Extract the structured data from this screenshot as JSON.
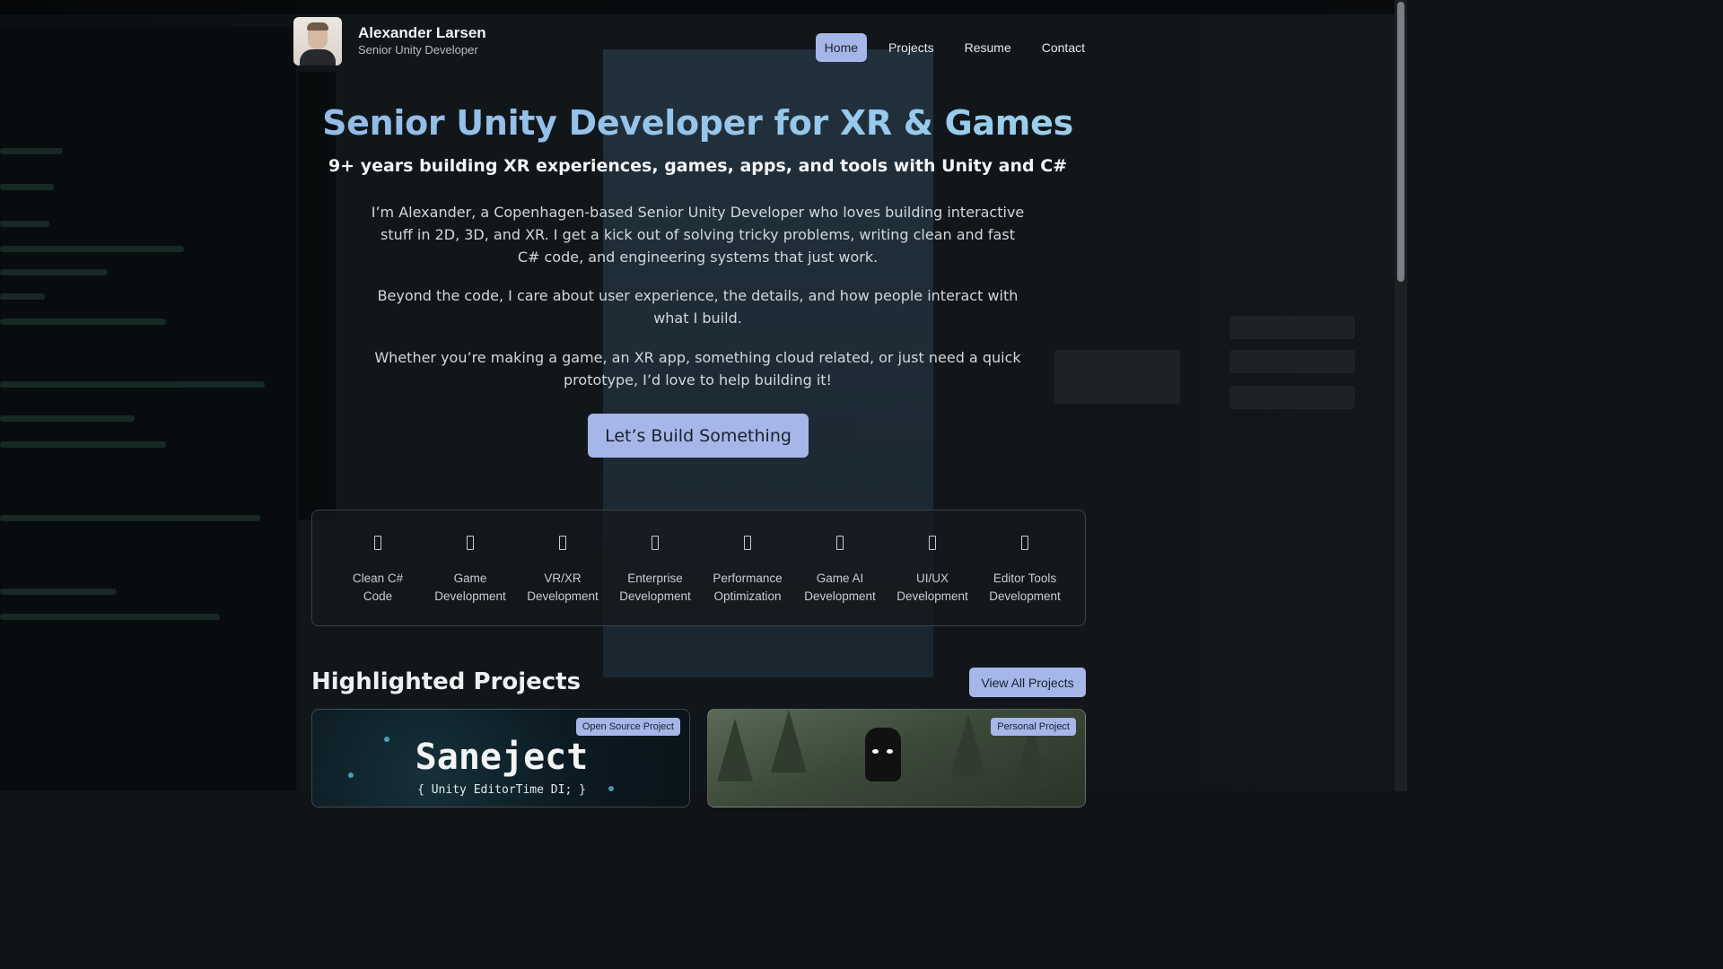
{
  "header": {
    "name": "Alexander Larsen",
    "role": "Senior Unity Developer",
    "nav": [
      "Home",
      "Projects",
      "Resume",
      "Contact"
    ],
    "active_nav": "Home"
  },
  "hero": {
    "title": "Senior Unity Developer for XR & Games",
    "subtitle": "9+ years building XR experiences, games, apps, and tools with Unity and C#",
    "paragraphs": [
      "I’m Alexander, a Copenhagen-based Senior Unity Developer who loves building interactive stuff in 2D, 3D, and XR. I get a kick out of solving tricky problems, writing clean and fast C# code, and engineering systems that just work.",
      "Beyond the code, I care about user experience, the details, and how people interact with what I build.",
      "Whether you’re making a game, an XR app, something cloud related, or just need a quick prototype, I’d love to help building it!"
    ],
    "cta": "Let’s Build Something"
  },
  "skills": [
    {
      "label": "Clean C# Code",
      "icon": "code-icon"
    },
    {
      "label": "Game Development",
      "icon": "gamepad-icon"
    },
    {
      "label": "VR/XR Development",
      "icon": "vr-headset-icon"
    },
    {
      "label": "Enterprise Development",
      "icon": "building-icon"
    },
    {
      "label": "Performance Optimization",
      "icon": "gauge-icon"
    },
    {
      "label": "Game AI Development",
      "icon": "brain-icon"
    },
    {
      "label": "UI/UX Development",
      "icon": "layout-icon"
    },
    {
      "label": "Editor Tools Development",
      "icon": "tools-icon"
    }
  ],
  "projects": {
    "heading": "Highlighted Projects",
    "view_all": "View All Projects",
    "cards": [
      {
        "badge": "Open Source Project",
        "title": "Saneject",
        "subtitle": "{ Unity EditorTime DI; }"
      },
      {
        "badge": "Personal Project"
      }
    ]
  },
  "colors": {
    "accent": "#a6b6e8",
    "title_gradient_start": "#8fb3e6",
    "title_gradient_end": "#9cd7ee",
    "background": "#101418"
  }
}
